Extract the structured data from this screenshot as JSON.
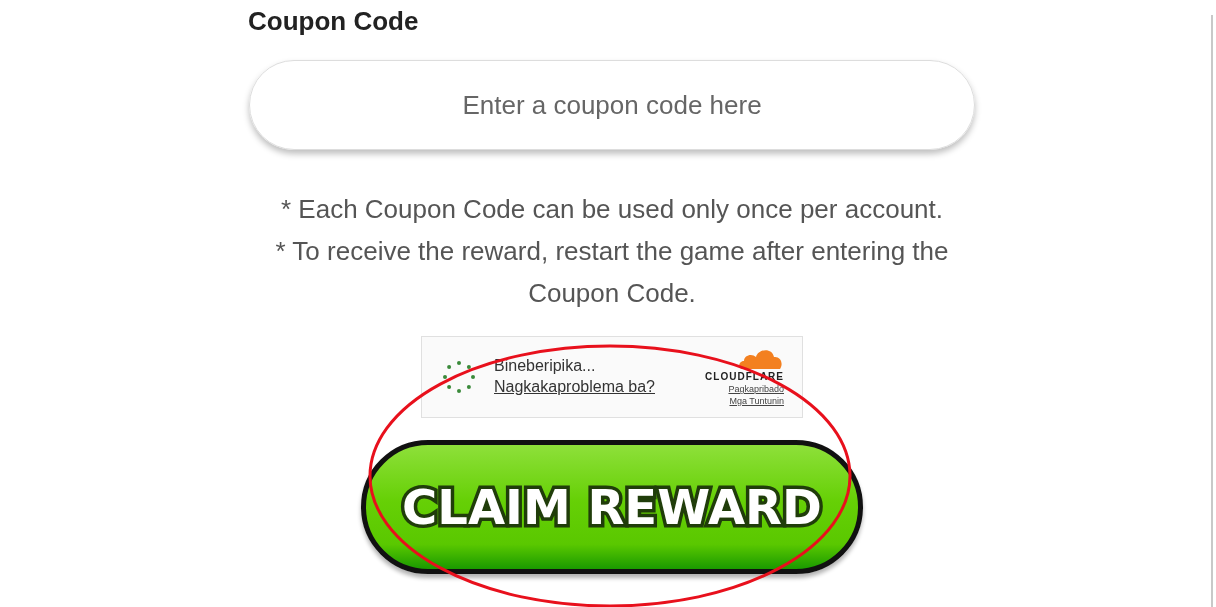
{
  "section_title": "Coupon Code",
  "coupon_field": {
    "placeholder": "Enter a coupon code here"
  },
  "notes": [
    "* Each Coupon Code can be used only once per account.",
    "* To receive the reward, restart the game after entering the Coupon Code."
  ],
  "verification_widget": {
    "status": "Bineberipika...",
    "help_link": "Nagkakaproblema ba?",
    "brand": "CLOUDFLARE",
    "links": [
      "Pagkapribado",
      "Mga Tuntunin"
    ]
  },
  "claim_button": {
    "label": "CLAIM REWARD"
  }
}
